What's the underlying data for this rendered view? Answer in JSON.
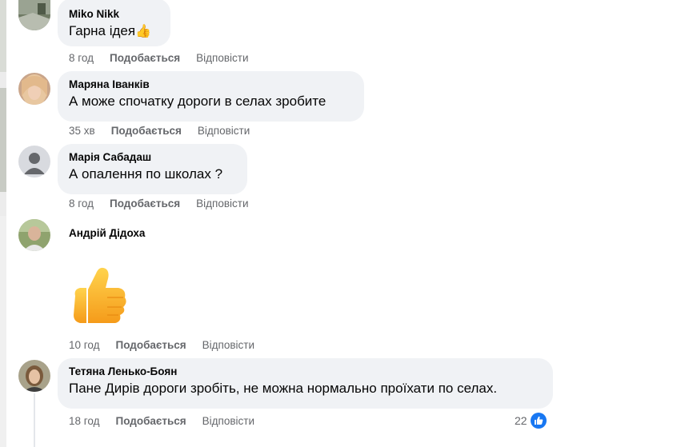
{
  "comments": [
    {
      "author": "Miko Nikk",
      "text": "Гарна ідея",
      "emoji": "👍",
      "time": "8 год",
      "like_label": "Подобається",
      "reply_label": "Відповісти"
    },
    {
      "author": "Маряна Іванків",
      "text": "А може спочатку дороги в селах зробите",
      "time": "35 хв",
      "like_label": "Подобається",
      "reply_label": "Відповісти"
    },
    {
      "author": "Марія Сабадаш",
      "text": "А опалення по школах ?",
      "time": "8 год",
      "like_label": "Подобається",
      "reply_label": "Відповісти"
    },
    {
      "author": "Андрій Дідоха",
      "sticker": "thumbs-up",
      "time": "10 год",
      "like_label": "Подобається",
      "reply_label": "Відповісти"
    },
    {
      "author": "Тетяна Ленько-Боян",
      "text": "Пане Дирів дороги зробіть, не можна нормально проїхати по селах.",
      "time": "18 год",
      "like_label": "Подобається",
      "reply_label": "Відповісти",
      "reaction_count": "22",
      "reaction_icon": "like-icon"
    }
  ],
  "colors": {
    "bubble": "#f0f2f5",
    "meta": "#65676b",
    "like_blue": "#1877f2"
  }
}
